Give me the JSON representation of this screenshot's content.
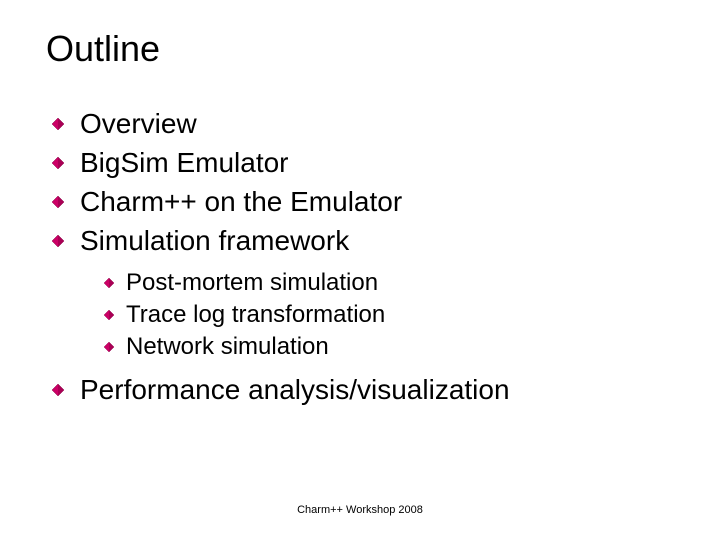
{
  "slide": {
    "title": "Outline",
    "main_items": [
      "Overview",
      "BigSim Emulator",
      "Charm++ on the Emulator",
      "Simulation framework"
    ],
    "sub_items": [
      "Post-mortem simulation",
      "Trace log transformation",
      "Network simulation"
    ],
    "last_item": "Performance analysis/visualization",
    "footer": "Charm++ Workshop 2008"
  },
  "colors": {
    "bullet_fill": "#cc0066",
    "bullet_stroke": "#880044"
  }
}
